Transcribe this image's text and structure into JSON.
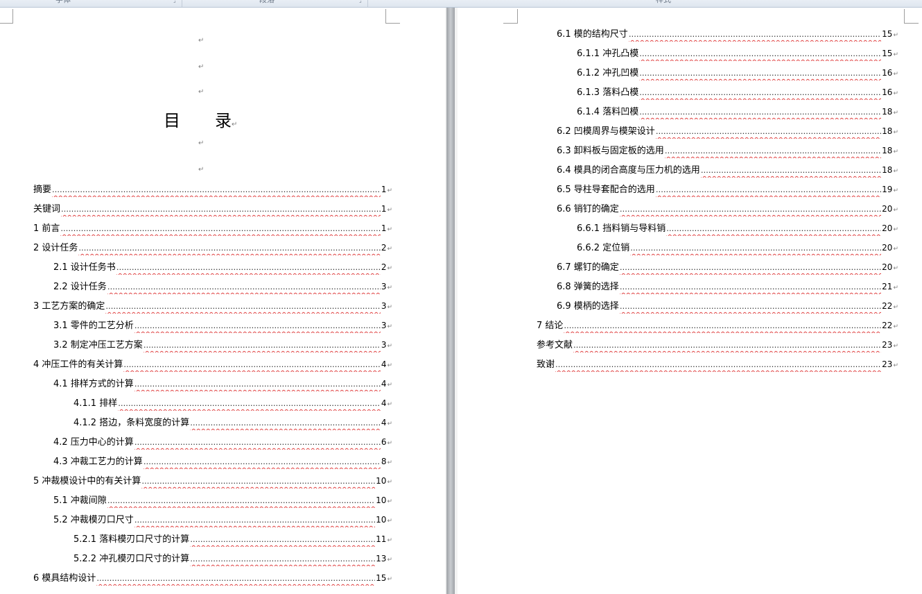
{
  "ribbon": {
    "groups": [
      "字体",
      "段落",
      "样式"
    ]
  },
  "title": {
    "char1": "目",
    "char2": "录"
  },
  "paragraph_mark": "↵",
  "leader_text": "…………………………………………………………………………………………………………………………………………………………………………………………………………………………………………",
  "left_page": [
    {
      "label": "摘要",
      "page": "1",
      "level": 0
    },
    {
      "label": "关键词",
      "page": "1",
      "level": 0
    },
    {
      "label": "1 前言",
      "page": "1",
      "level": 0
    },
    {
      "label": "2 设计任务",
      "page": "2",
      "level": 0
    },
    {
      "label": "2.1 设计任务书",
      "page": "2",
      "level": 1
    },
    {
      "label": "2.2 设计任务",
      "page": "3",
      "level": 1
    },
    {
      "label": "3 工艺方案的确定",
      "page": "3",
      "level": 0
    },
    {
      "label": "3.1 零件的工艺分析",
      "page": "3",
      "level": 1
    },
    {
      "label": "3.2 制定冲压工艺方案",
      "page": "3",
      "level": 1
    },
    {
      "label": "4 冲压工件的有关计算",
      "page": "4",
      "level": 0
    },
    {
      "label": "4.1 排样方式的计算",
      "page": "4",
      "level": 1
    },
    {
      "label": "4.1.1 排样",
      "page": "4",
      "level": 2
    },
    {
      "label": "4.1.2 搭边，条料宽度的计算",
      "page": "4",
      "level": 2
    },
    {
      "label": "4.2 压力中心的计算",
      "page": "6",
      "level": 1
    },
    {
      "label": "4.3 冲裁工艺力的计算",
      "page": "8",
      "level": 1
    },
    {
      "label": "5 冲裁模设计中的有关计算",
      "page": "10",
      "level": 0
    },
    {
      "label": "5.1 冲裁间隙",
      "page": "10",
      "level": 1
    },
    {
      "label": "5.2 冲裁模刃口尺寸",
      "page": "10",
      "level": 1
    },
    {
      "label": "5.2.1 落料模刃口尺寸的计算",
      "page": "11",
      "level": 2
    },
    {
      "label": "5.2.2 冲孔模刃口尺寸的计算",
      "page": "13",
      "level": 2
    },
    {
      "label": "6 模具结构设计",
      "page": "15",
      "level": 0
    }
  ],
  "right_page": [
    {
      "label": "6.1 模的结构尺寸",
      "page": "15",
      "level": 1
    },
    {
      "label": "6.1.1 冲孔凸模",
      "page": "15",
      "level": 2
    },
    {
      "label": "6.1.2 冲孔凹模",
      "page": "16",
      "level": 2
    },
    {
      "label": "6.1.3 落料凸模",
      "page": "16",
      "level": 2
    },
    {
      "label": "6.1.4 落料凹模",
      "page": "18",
      "level": 2
    },
    {
      "label": "6.2 凹模周界与模架设计",
      "page": "18",
      "level": 1
    },
    {
      "label": "6.3 卸料板与固定板的选用",
      "page": "18",
      "level": 1
    },
    {
      "label": "6.4 模具的闭合高度与压力机的选用",
      "page": "18",
      "level": 1
    },
    {
      "label": "6.5 导柱导套配合的选用",
      "page": "19",
      "level": 1
    },
    {
      "label": "6.6 销钉的确定",
      "page": "20",
      "level": 1
    },
    {
      "label": "6.6.1 挡料销与导料销",
      "page": "20",
      "level": 2
    },
    {
      "label": "6.6.2 定位销",
      "page": "20",
      "level": 2
    },
    {
      "label": "6.7 螺钉的确定",
      "page": "20",
      "level": 1
    },
    {
      "label": "6.8 弹簧的选择",
      "page": "21",
      "level": 1
    },
    {
      "label": "6.9 模柄的选择",
      "page": "22",
      "level": 1
    },
    {
      "label": "7 结论",
      "page": "22",
      "level": 0
    },
    {
      "label": "参考文献",
      "page": "23",
      "level": 0
    },
    {
      "label": "致谢",
      "page": "23",
      "level": 0
    }
  ]
}
